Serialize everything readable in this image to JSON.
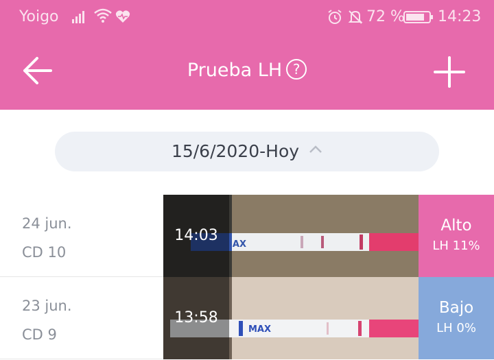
{
  "status_bar": {
    "carrier": "Yoigo",
    "battery": "72 %",
    "time": "14:23",
    "icons": [
      "signal-icon",
      "wifi-icon",
      "heart-icon",
      "alarm-icon",
      "bell-off-icon",
      "battery-icon"
    ]
  },
  "header": {
    "title": "Prueba LH",
    "help_glyph": "?",
    "back_icon": "arrow-left-icon",
    "add_icon": "plus-icon"
  },
  "date_selector": {
    "label": "15/6/2020-Hoy",
    "icon": "chevron-up-icon"
  },
  "tests": [
    {
      "date": "24 jun.",
      "cycle_day": "CD 10",
      "time": "14:03",
      "level": "Alto",
      "lh": "LH 11%",
      "strip_label": "MAX",
      "result_color": "#E76AAC"
    },
    {
      "date": "23 jun.",
      "cycle_day": "CD 9",
      "time": "13:58",
      "level": "Bajo",
      "lh": "LH 0%",
      "strip_label": "MAX",
      "result_color": "#86A9DB"
    }
  ],
  "colors": {
    "header": "#E76AAC",
    "high": "#E76AAC",
    "low": "#86A9DB",
    "pill_bg": "#eef1f6"
  }
}
